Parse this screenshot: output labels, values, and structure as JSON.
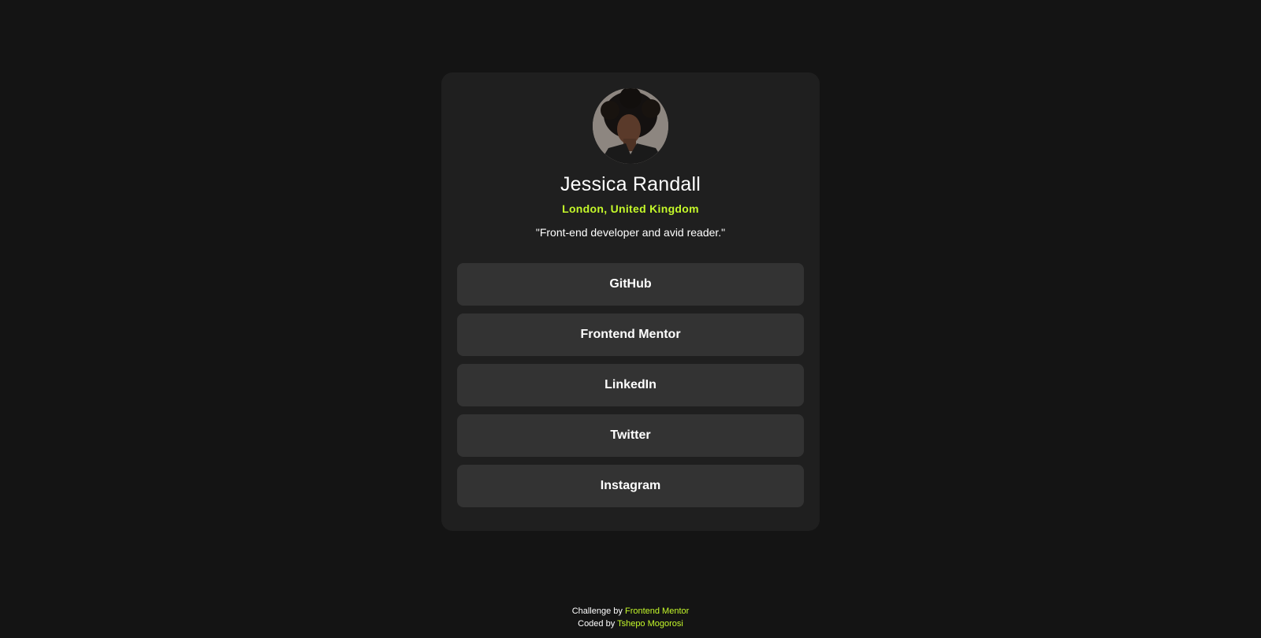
{
  "profile": {
    "name": "Jessica Randall",
    "location": "London, United Kingdom",
    "bio": "\"Front-end developer and avid reader.\""
  },
  "links": [
    {
      "label": "GitHub"
    },
    {
      "label": "Frontend Mentor"
    },
    {
      "label": "LinkedIn"
    },
    {
      "label": "Twitter"
    },
    {
      "label": "Instagram"
    }
  ],
  "attribution": {
    "challenge_prefix": "Challenge by",
    "challenge_link": "Frontend Mentor",
    "coded_prefix": "Coded by",
    "coded_link": "Tshepo Mogorosi"
  },
  "colors": {
    "page_background": "#141414",
    "card_background": "#1f1f1f",
    "button_background": "#333333",
    "accent": "#c4f82a",
    "text": "#ffffff"
  }
}
